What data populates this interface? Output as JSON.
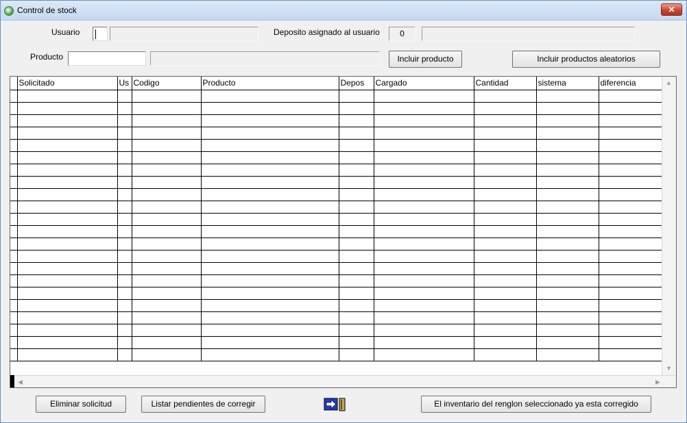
{
  "window": {
    "title": "Control de stock",
    "close_glyph": "✕"
  },
  "usuario": {
    "label": "Usuario",
    "code": "",
    "name": ""
  },
  "deposito": {
    "label": "Deposito asignado al usuario",
    "number": "0",
    "name": ""
  },
  "producto": {
    "label": "Producto",
    "code": "",
    "name": ""
  },
  "buttons": {
    "incluir_producto": "Incluir producto",
    "incluir_aleatorios": "Incluir productos aleatorios",
    "eliminar_solicitud": "Eliminar solicitud",
    "listar_pendientes": "Listar pendientes de corregir",
    "marcar_corregido": "El inventario del renglon seleccionado ya esta corregido"
  },
  "grid": {
    "columns": [
      "Solicitado",
      "Us",
      "Codigo",
      "Producto",
      "Depos",
      "Cargado",
      "Cantidad",
      "sistema",
      "diferencia"
    ],
    "rows": [
      [
        "",
        "",
        "",
        "",
        "",
        "",
        "",
        "",
        ""
      ],
      [
        "",
        "",
        "",
        "",
        "",
        "",
        "",
        "",
        ""
      ],
      [
        "",
        "",
        "",
        "",
        "",
        "",
        "",
        "",
        ""
      ],
      [
        "",
        "",
        "",
        "",
        "",
        "",
        "",
        "",
        ""
      ],
      [
        "",
        "",
        "",
        "",
        "",
        "",
        "",
        "",
        ""
      ],
      [
        "",
        "",
        "",
        "",
        "",
        "",
        "",
        "",
        ""
      ],
      [
        "",
        "",
        "",
        "",
        "",
        "",
        "",
        "",
        ""
      ],
      [
        "",
        "",
        "",
        "",
        "",
        "",
        "",
        "",
        ""
      ],
      [
        "",
        "",
        "",
        "",
        "",
        "",
        "",
        "",
        ""
      ],
      [
        "",
        "",
        "",
        "",
        "",
        "",
        "",
        "",
        ""
      ],
      [
        "",
        "",
        "",
        "",
        "",
        "",
        "",
        "",
        ""
      ],
      [
        "",
        "",
        "",
        "",
        "",
        "",
        "",
        "",
        ""
      ],
      [
        "",
        "",
        "",
        "",
        "",
        "",
        "",
        "",
        ""
      ],
      [
        "",
        "",
        "",
        "",
        "",
        "",
        "",
        "",
        ""
      ],
      [
        "",
        "",
        "",
        "",
        "",
        "",
        "",
        "",
        ""
      ],
      [
        "",
        "",
        "",
        "",
        "",
        "",
        "",
        "",
        ""
      ],
      [
        "",
        "",
        "",
        "",
        "",
        "",
        "",
        "",
        ""
      ],
      [
        "",
        "",
        "",
        "",
        "",
        "",
        "",
        "",
        ""
      ],
      [
        "",
        "",
        "",
        "",
        "",
        "",
        "",
        "",
        ""
      ],
      [
        "",
        "",
        "",
        "",
        "",
        "",
        "",
        "",
        ""
      ],
      [
        "",
        "",
        "",
        "",
        "",
        "",
        "",
        "",
        ""
      ],
      [
        "",
        "",
        "",
        "",
        "",
        "",
        "",
        "",
        ""
      ]
    ]
  },
  "icons": {
    "app": "app-icon",
    "navigate": "exit-arrow-icon",
    "scroll_up": "▲",
    "scroll_down": "▼",
    "scroll_left": "◀",
    "scroll_right": "▶"
  }
}
